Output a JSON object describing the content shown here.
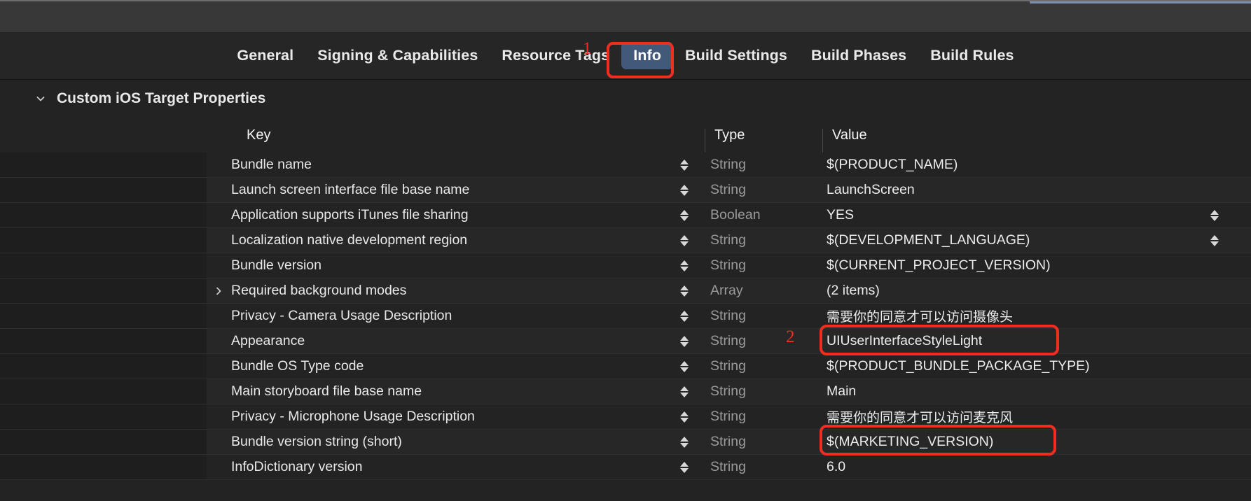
{
  "window": {
    "top_strip_accent_color": "#7a90ad",
    "background_color": "#232323"
  },
  "tabs": [
    {
      "label": "General",
      "selected": false
    },
    {
      "label": "Signing & Capabilities",
      "selected": false
    },
    {
      "label": "Resource Tags",
      "selected": false
    },
    {
      "label": "Info",
      "selected": true
    },
    {
      "label": "Build Settings",
      "selected": false
    },
    {
      "label": "Build Phases",
      "selected": false
    },
    {
      "label": "Build Rules",
      "selected": false
    }
  ],
  "section": {
    "title": "Custom iOS Target Properties",
    "disclosure_icon": "chevron-down-icon",
    "expanded": true
  },
  "table": {
    "columns": [
      "Key",
      "Type",
      "Value"
    ],
    "rows": [
      {
        "key": "Bundle name",
        "type": "String",
        "value": "$(PRODUCT_NAME)",
        "stepper": true,
        "right_stepper": false,
        "disclosure": false,
        "cjk": false
      },
      {
        "key": "Launch screen interface file base name",
        "type": "String",
        "value": "LaunchScreen",
        "stepper": true,
        "right_stepper": false,
        "disclosure": false,
        "cjk": false
      },
      {
        "key": "Application supports iTunes file sharing",
        "type": "Boolean",
        "value": "YES",
        "stepper": true,
        "right_stepper": true,
        "disclosure": false,
        "cjk": false
      },
      {
        "key": "Localization native development region",
        "type": "String",
        "value": "$(DEVELOPMENT_LANGUAGE)",
        "stepper": true,
        "right_stepper": true,
        "disclosure": false,
        "cjk": false
      },
      {
        "key": "Bundle version",
        "type": "String",
        "value": "$(CURRENT_PROJECT_VERSION)",
        "stepper": true,
        "right_stepper": false,
        "disclosure": false,
        "cjk": false
      },
      {
        "key": "Required background modes",
        "type": "Array",
        "value": "(2 items)",
        "stepper": true,
        "right_stepper": false,
        "disclosure": true,
        "cjk": false
      },
      {
        "key": "Privacy - Camera Usage Description",
        "type": "String",
        "value": "需要你的同意才可以访问摄像头",
        "stepper": true,
        "right_stepper": false,
        "disclosure": false,
        "cjk": true
      },
      {
        "key": "Appearance",
        "type": "String",
        "value": "UIUserInterfaceStyleLight",
        "stepper": true,
        "right_stepper": false,
        "disclosure": false,
        "cjk": false
      },
      {
        "key": "Bundle OS Type code",
        "type": "String",
        "value": "$(PRODUCT_BUNDLE_PACKAGE_TYPE)",
        "stepper": true,
        "right_stepper": false,
        "disclosure": false,
        "cjk": false
      },
      {
        "key": "Main storyboard file base name",
        "type": "String",
        "value": "Main",
        "stepper": true,
        "right_stepper": false,
        "disclosure": false,
        "cjk": false
      },
      {
        "key": "Privacy - Microphone Usage Description",
        "type": "String",
        "value": "需要你的同意才可以访问麦克风",
        "stepper": true,
        "right_stepper": false,
        "disclosure": false,
        "cjk": true
      },
      {
        "key": "Bundle version string (short)",
        "type": "String",
        "value": "$(MARKETING_VERSION)",
        "stepper": true,
        "right_stepper": false,
        "disclosure": false,
        "cjk": false
      },
      {
        "key": "InfoDictionary version",
        "type": "String",
        "value": "6.0",
        "stepper": true,
        "right_stepper": false,
        "disclosure": false,
        "cjk": false
      }
    ]
  },
  "annotations": {
    "color": "#f02d20",
    "marks": [
      {
        "number": "1",
        "target": "Info tab"
      },
      {
        "number": "2",
        "target": "Privacy - Camera Usage Description value"
      }
    ]
  }
}
